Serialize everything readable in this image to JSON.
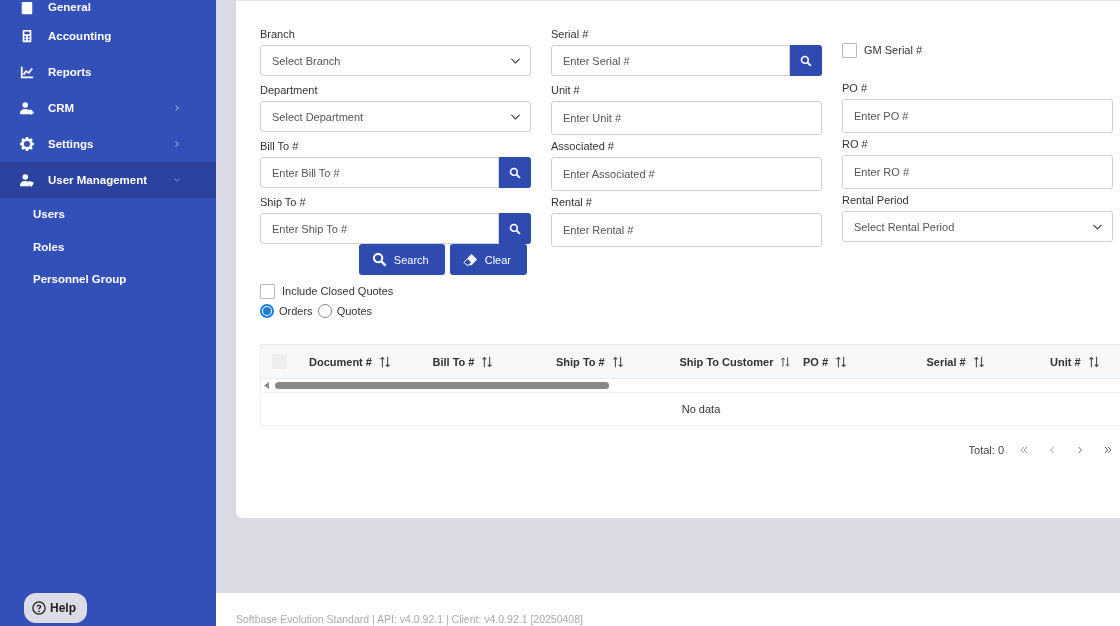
{
  "sidebar": {
    "items": [
      {
        "label": "General",
        "selected": false
      },
      {
        "label": "Accounting",
        "selected": false
      },
      {
        "label": "Reports",
        "selected": false
      },
      {
        "label": "CRM",
        "selected": false,
        "expanded": false
      },
      {
        "label": "Settings",
        "selected": false,
        "expanded": false
      },
      {
        "label": "User Management",
        "selected": true,
        "expanded": true,
        "children": [
          {
            "label": "Users"
          },
          {
            "label": "Roles"
          },
          {
            "label": "Personnel Group"
          }
        ]
      }
    ],
    "help_button": {
      "label": "Help"
    }
  },
  "filters": {
    "columns": [
      {
        "fields": [
          {
            "kind": "select",
            "label": "Branch",
            "placeholder": "Select Branch"
          },
          {
            "kind": "select",
            "label": "Department",
            "placeholder": "Select Department"
          },
          {
            "kind": "search",
            "label": "Bill To #",
            "placeholder": "Enter Bill To #"
          },
          {
            "kind": "search",
            "label": "Ship To #",
            "placeholder": "Enter Ship To #"
          }
        ]
      },
      {
        "fields": [
          {
            "kind": "search",
            "label": "Serial #",
            "placeholder": "Enter Serial #"
          },
          {
            "kind": "text",
            "label": "Unit #",
            "placeholder": "Enter Unit #"
          },
          {
            "kind": "text",
            "label": "Associated #",
            "placeholder": "Enter Associated #"
          },
          {
            "kind": "text",
            "label": "Rental #",
            "placeholder": "Enter Rental #"
          }
        ]
      },
      {
        "fields": [
          {
            "kind": "checkbox",
            "label": "GM Serial #",
            "checked": false
          },
          {
            "kind": "text",
            "label": "PO #",
            "placeholder": "Enter PO #"
          },
          {
            "kind": "text",
            "label": "RO #",
            "placeholder": "Enter RO #"
          },
          {
            "kind": "select",
            "label": "Rental Period",
            "placeholder": "Select Rental Period"
          }
        ]
      }
    ],
    "actions": [
      {
        "label": "Search"
      },
      {
        "label": "Clear"
      }
    ],
    "include_closed_quotes": {
      "label": "Include Closed Quotes",
      "checked": false
    },
    "document_type": [
      {
        "label": "Orders",
        "selected": true
      },
      {
        "label": "Quotes",
        "selected": false
      }
    ]
  },
  "table": {
    "select_all": {
      "checked": false
    },
    "columns": [
      "Document #",
      "Bill To #",
      "Ship To #",
      "Ship To Customer",
      "PO #",
      "Serial #",
      "Unit #"
    ],
    "empty_text": "No data"
  },
  "pagination": {
    "total": "Total: 0"
  },
  "footer": {
    "text": "Softbase Evolution Standard | API: v4.0.92.1 | Client: v4.0.92.1 [20250408]"
  }
}
